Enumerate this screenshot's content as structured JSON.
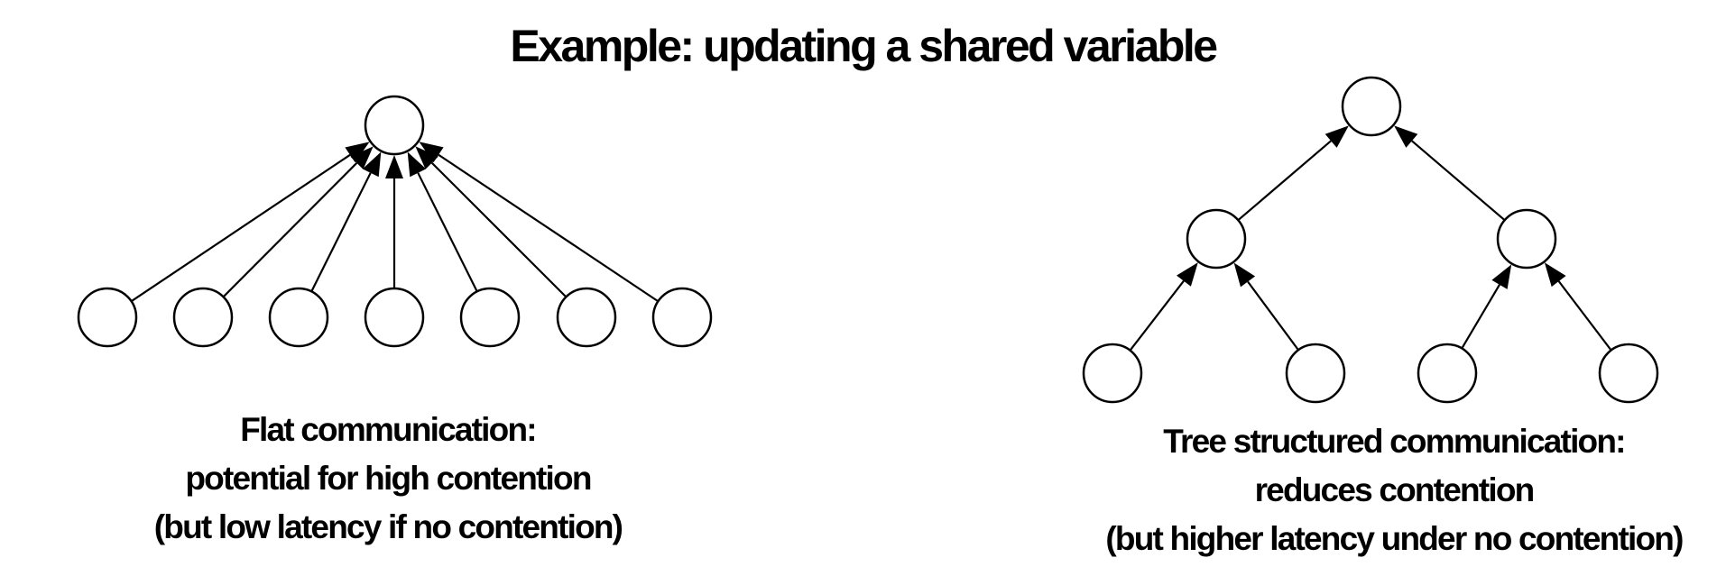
{
  "title": "Example: updating a shared variable",
  "flat": {
    "caption": [
      "Flat communication:",
      "potential for high contention",
      "(but low latency if no contention)"
    ]
  },
  "tree": {
    "caption": [
      "Tree structured communication:",
      "reduces contention",
      "(but higher latency under no contention)"
    ]
  }
}
